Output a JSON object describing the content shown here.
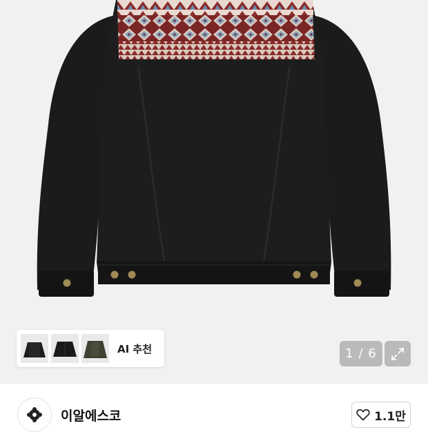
{
  "gallery": {
    "ai_recommend_label": "AI 추천",
    "counter": "1 / 6"
  },
  "shop": {
    "name": "이알에스코",
    "like_count": "1.1만"
  },
  "icons": {
    "expand": "expand-icon",
    "heart": "heart-icon",
    "chevron": "chevron-right-icon"
  },
  "colors": {
    "jacket": "#181818",
    "pattern_red": "#8a2a2a",
    "pattern_blue": "#6c8fb0",
    "button_brass": "#a08a55"
  }
}
